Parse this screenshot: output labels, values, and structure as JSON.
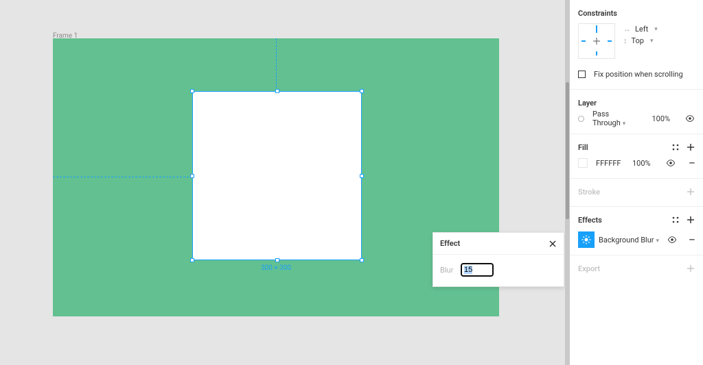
{
  "canvas": {
    "frame_label": "Frame 1",
    "selection_dimensions": "300 × 300"
  },
  "popover": {
    "title": "Effect",
    "blur_label": "Blur",
    "blur_value": "15"
  },
  "panel": {
    "constraints": {
      "title": "Constraints",
      "horizontal": "Left",
      "vertical": "Top",
      "fix_label": "Fix position when scrolling"
    },
    "layer": {
      "title": "Layer",
      "blend_mode": "Pass Through",
      "opacity": "100%"
    },
    "fill": {
      "title": "Fill",
      "hex": "FFFFFF",
      "opacity": "100%"
    },
    "stroke": {
      "title": "Stroke"
    },
    "effects": {
      "title": "Effects",
      "item_name": "Background Blur"
    },
    "export": {
      "title": "Export"
    }
  }
}
